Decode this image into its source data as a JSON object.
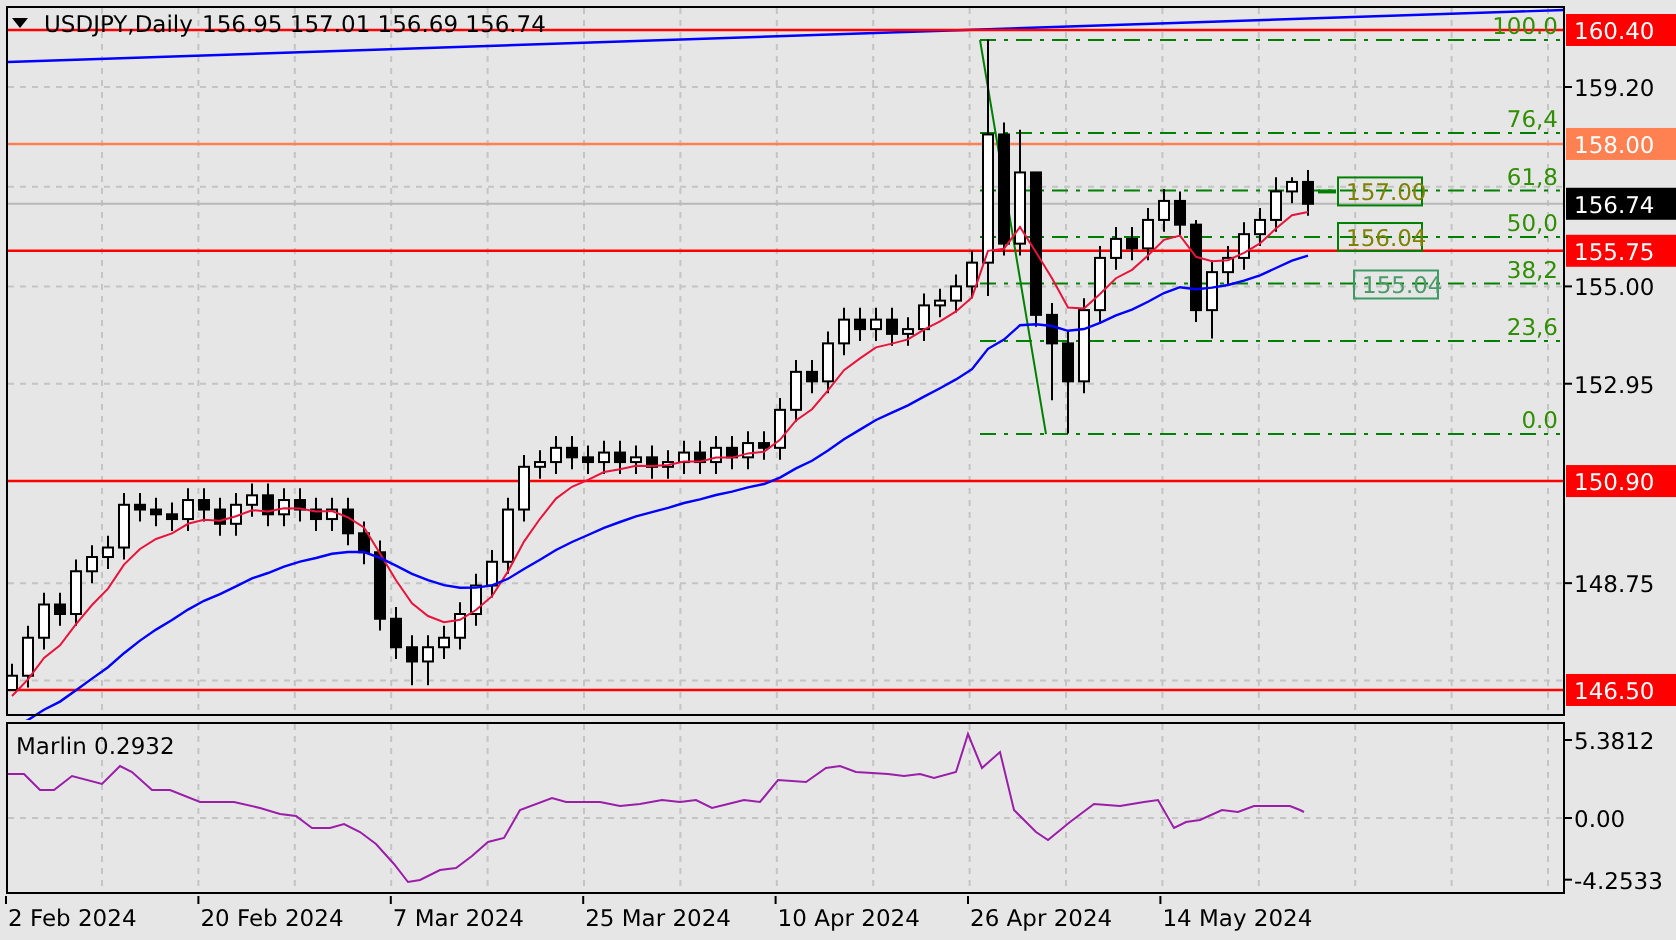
{
  "chart": {
    "title": "USDJPY,Daily",
    "ohlc": [
      "156.95",
      "157.01",
      "156.69",
      "156.74"
    ],
    "price_ticks": [
      "159.20",
      "155.00",
      "152.95",
      "148.75"
    ],
    "price_levels": [
      {
        "price": "160.40",
        "color": "#ff0000"
      },
      {
        "price": "158.00",
        "color": "#ff8050"
      },
      {
        "price": "155.75",
        "color": "#ff0000"
      },
      {
        "price": "150.90",
        "color": "#ff0000"
      },
      {
        "price": "146.50",
        "color": "#ff0000"
      }
    ],
    "current_price": "156.74",
    "fibonacci_levels": [
      "100.0",
      "76,4",
      "61,8",
      "50,0",
      "38,2",
      "23,6",
      "0.0"
    ],
    "price_boxes": [
      "157.00",
      "156.04",
      "155.04"
    ]
  },
  "indicator": {
    "label": "Marlin 0.2932",
    "scale": [
      "5.3812",
      "0.00",
      "-4.2533"
    ]
  },
  "dates": [
    "2 Feb 2024",
    "20 Feb 2024",
    "7 Mar 2024",
    "25 Mar 2024",
    "10 Apr 2024",
    "26 Apr 2024",
    "14 May 2024"
  ]
}
